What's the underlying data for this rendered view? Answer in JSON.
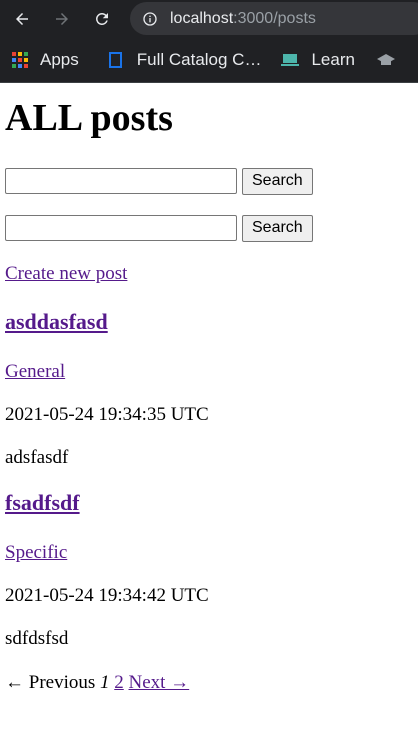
{
  "browser": {
    "url_host": "localhost",
    "url_rest": ":3000/posts",
    "bookmarks": [
      {
        "label": "Apps",
        "icon": "apps-grid-icon"
      },
      {
        "label": "Full Catalog C…",
        "icon": "bookmark-page-icon"
      },
      {
        "label": "Learn",
        "icon": "laptop-icon"
      }
    ]
  },
  "page": {
    "title": "ALL posts",
    "search_forms": [
      {
        "value": "",
        "button": "Search"
      },
      {
        "value": "",
        "button": "Search"
      }
    ],
    "create_link": "Create new post",
    "posts": [
      {
        "title": "asddasfasd",
        "category": "General",
        "timestamp": "2021-05-24 19:34:35 UTC",
        "body": "adsfasdf"
      },
      {
        "title": "fsadfsdf",
        "category": "Specific",
        "timestamp": "2021-05-24 19:34:42 UTC",
        "body": "sdfdsfsd"
      }
    ],
    "pagination": {
      "previous": "← Previous",
      "current": "1",
      "page2": "2",
      "next": "Next →"
    }
  },
  "colors": {
    "chrome_bg": "#202124",
    "omnibox_bg": "#35363a",
    "link": "#551a8b"
  }
}
